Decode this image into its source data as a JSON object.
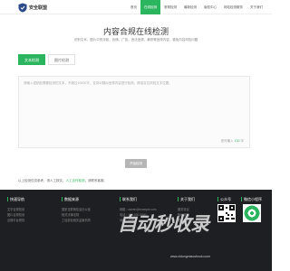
{
  "brand": {
    "name": "安全联盟",
    "logo_icon": "shield-logo-icon"
  },
  "nav": [
    {
      "label": "首页",
      "active": false
    },
    {
      "label": "在线检测",
      "active": true
    },
    {
      "label": "常规检测",
      "active": false
    },
    {
      "label": "最新检测",
      "active": false
    },
    {
      "label": "版权中心",
      "active": false
    },
    {
      "label": "网站检测服务",
      "active": false
    },
    {
      "label": "关于我们",
      "active": false
    }
  ],
  "hero": {
    "title": "内容合规在线检测",
    "subtitle": "识别文本、图片中的涉政、色情、广告、违法违规、暴恐等违规内容，避免内容风险问题"
  },
  "tabs": [
    {
      "label": "文本检测",
      "active": true
    },
    {
      "label": "图片检测",
      "active": false
    }
  ],
  "editor": {
    "placeholder": "请输入或粘贴需要检测的文本，不超过10000字，支持对疑似违规内容进行检测，精准定位风险文字位置。",
    "counter_prefix": "还可输入",
    "counter_value": "100",
    "counter_suffix": "字"
  },
  "actions": {
    "submit_label": "开始检测"
  },
  "note": {
    "prefix": "以上检测仅供参考，请人工核实，",
    "link": "人工合作检测",
    "suffix": "，请联系客服。"
  },
  "footer": {
    "columns": [
      {
        "heading": "快速导航",
        "items": [
          "文字合规检测",
          "图片合规检测",
          "近期平台规则"
        ]
      },
      {
        "heading": "数据来源",
        "items": [
          "国家互联网信息办公室",
          "相关法律法规",
          "工信部及相关监管机构"
        ]
      },
      {
        "heading": "联系我们",
        "items": [
          "邮箱：admin@example.com",
          "电话：400-000-0000",
          "地址：中国"
        ]
      },
      {
        "heading": "关于我们",
        "items": [
          "服务协议",
          "隐私政策",
          "联系我们"
        ]
      },
      {
        "heading": "公众号",
        "items": []
      },
      {
        "heading": "微信小程序",
        "items": []
      }
    ]
  },
  "watermark": {
    "text": "自动秒收录",
    "url": "www.zidongmiaoshoulu.com"
  },
  "colors": {
    "accent": "#2cb55f",
    "footer_bg": "#1e1f22"
  }
}
